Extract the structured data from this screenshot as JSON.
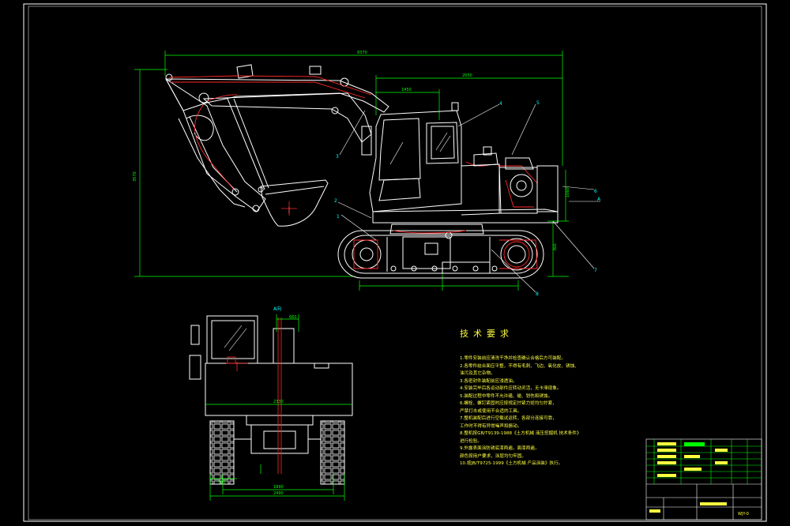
{
  "drawing": {
    "side_view": {
      "dimension_labels": {
        "overall_length": "8370",
        "cab_width": "2650",
        "counterweight_width": "1450",
        "overall_height": "3570",
        "track_height": "360",
        "swing_height": "1060"
      },
      "balloons": [
        "1",
        "2",
        "3",
        "4",
        "5",
        "6",
        "7",
        "8"
      ],
      "view_arrow_label": "A"
    },
    "front_view": {
      "title": "A向",
      "dimension_labels": {
        "upper_width": "2330",
        "track_gauge": "1990",
        "overall_width": "2490",
        "shoe_width": "500",
        "top_detail": "660"
      }
    }
  },
  "tech_requirements": {
    "title": "技术要求",
    "items": [
      "1.零件安装前应清洗干净并检查确认合格后方可装配。",
      "2.各零件结合面应平整，不得有毛刺、飞边、氧化皮、锈蚀、",
      "  油污及其它杂物。",
      "3.各密封件装配前应浸透油。",
      "4.安装完毕后各运动部件应转动灵活，无卡滞现象。",
      "5.装配过程中零件不允许磕、碰、划伤和锈蚀。",
      "6.螺栓、螺钉紧固时应按规定拧紧力矩均匀拧紧，",
      "  严禁打击或使用不合适的工具。",
      "7.整机装配后进行空载试运转，各部分连接可靠，",
      "  工作时不得有异常噪声和振动。",
      "8.整机按GB/T9139-1988《土方机械 液压挖掘机 技术条件》",
      "  进行检验。",
      "9.外露表面涂防锈底漆两遍，面漆两遍，",
      "  颜色按用户要求，涂层均匀牢固。",
      "10.按JB/T9725-1999《土方机械 产品涂装》执行。"
    ]
  },
  "title_block": {
    "drawing_number": "WJY-0"
  },
  "colors": {
    "background": "#000000",
    "outline": "#ffffff",
    "dimension": "#00ff00",
    "highlight": "#ff2a2a",
    "text": "#ffff40",
    "balloon": "#00ffff"
  }
}
